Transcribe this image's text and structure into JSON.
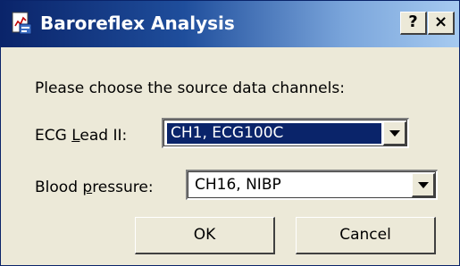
{
  "window": {
    "title": "Baroreflex Analysis",
    "app_icon": "document-chart-icon",
    "help_label": "?",
    "close_label": "×"
  },
  "prompt": "Please choose the source data channels:",
  "fields": {
    "ecg": {
      "label_pre": "ECG ",
      "label_mnemonic": "L",
      "label_post": "ead II:",
      "value": "CH1, ECG100C"
    },
    "bp": {
      "label_pre": "Blood ",
      "label_mnemonic": "p",
      "label_post": "ressure:",
      "value": "CH16, NIBP"
    }
  },
  "buttons": {
    "ok": "OK",
    "cancel": "Cancel"
  },
  "colors": {
    "title_bar": "#0a246a",
    "selection": "#0a246a",
    "face": "#ece9d8"
  }
}
